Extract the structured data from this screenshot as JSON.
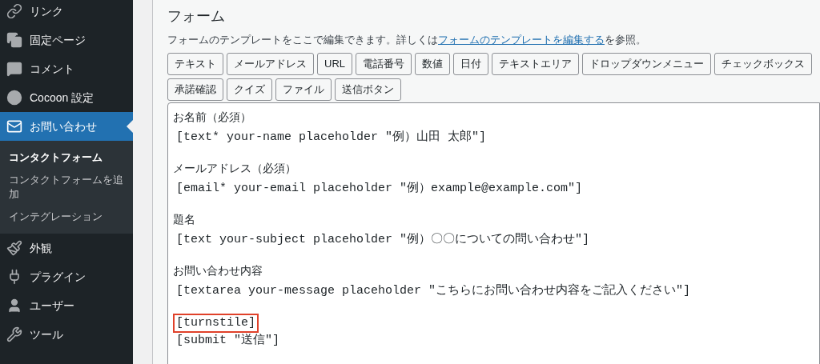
{
  "sidebar": {
    "items": [
      {
        "label": "リンク",
        "kind": "link",
        "selected": false
      },
      {
        "label": "固定ページ",
        "kind": "pages",
        "selected": false
      },
      {
        "label": "コメント",
        "kind": "comment",
        "selected": false
      },
      {
        "label": "Cocoon 設定",
        "kind": "circle",
        "selected": false
      },
      {
        "label": "お問い合わせ",
        "kind": "mail",
        "selected": true,
        "submenu": [
          {
            "label": "コンタクトフォーム",
            "selected": true
          },
          {
            "label": "コンタクトフォームを追加",
            "selected": false
          },
          {
            "label": "インテグレーション",
            "selected": false
          }
        ]
      },
      {
        "label": "外観",
        "kind": "brush",
        "selected": false
      },
      {
        "label": "プラグイン",
        "kind": "plug",
        "selected": false
      },
      {
        "label": "ユーザー",
        "kind": "user",
        "selected": false
      },
      {
        "label": "ツール",
        "kind": "wrench",
        "selected": false
      }
    ]
  },
  "panel": {
    "title": "フォーム",
    "description": {
      "before": "フォームのテンプレートをここで編集できます。詳しくは",
      "link": "フォームのテンプレートを編集する",
      "after": "を参照。"
    },
    "tag_buttons": [
      "テキスト",
      "メールアドレス",
      "URL",
      "電話番号",
      "数値",
      "日付",
      "テキストエリア",
      "ドロップダウンメニュー",
      "チェックボックス",
      "承諾確認",
      "クイズ",
      "ファイル",
      "送信ボタン"
    ],
    "editor": {
      "lines": [
        {
          "kind": "label",
          "text": "お名前（必須）"
        },
        {
          "kind": "code",
          "text": "[text* your-name placeholder \"例）山田 太郎\"]"
        },
        {
          "kind": "blank"
        },
        {
          "kind": "label",
          "text": "メールアドレス（必須）"
        },
        {
          "kind": "code",
          "text": "[email* your-email placeholder \"例）example@example.com\"]"
        },
        {
          "kind": "blank"
        },
        {
          "kind": "label",
          "text": "題名"
        },
        {
          "kind": "code",
          "text": "[text your-subject placeholder \"例）〇〇についての問い合わせ\"]"
        },
        {
          "kind": "blank"
        },
        {
          "kind": "label",
          "text": "お問い合わせ内容"
        },
        {
          "kind": "code",
          "text": "[textarea your-message placeholder \"こちらにお問い合わせ内容をご記入ください\"]"
        },
        {
          "kind": "blank"
        },
        {
          "kind": "code",
          "text": "[turnstile]",
          "highlighted": true
        },
        {
          "kind": "code",
          "text": "[submit \"送信\"]"
        }
      ]
    }
  }
}
